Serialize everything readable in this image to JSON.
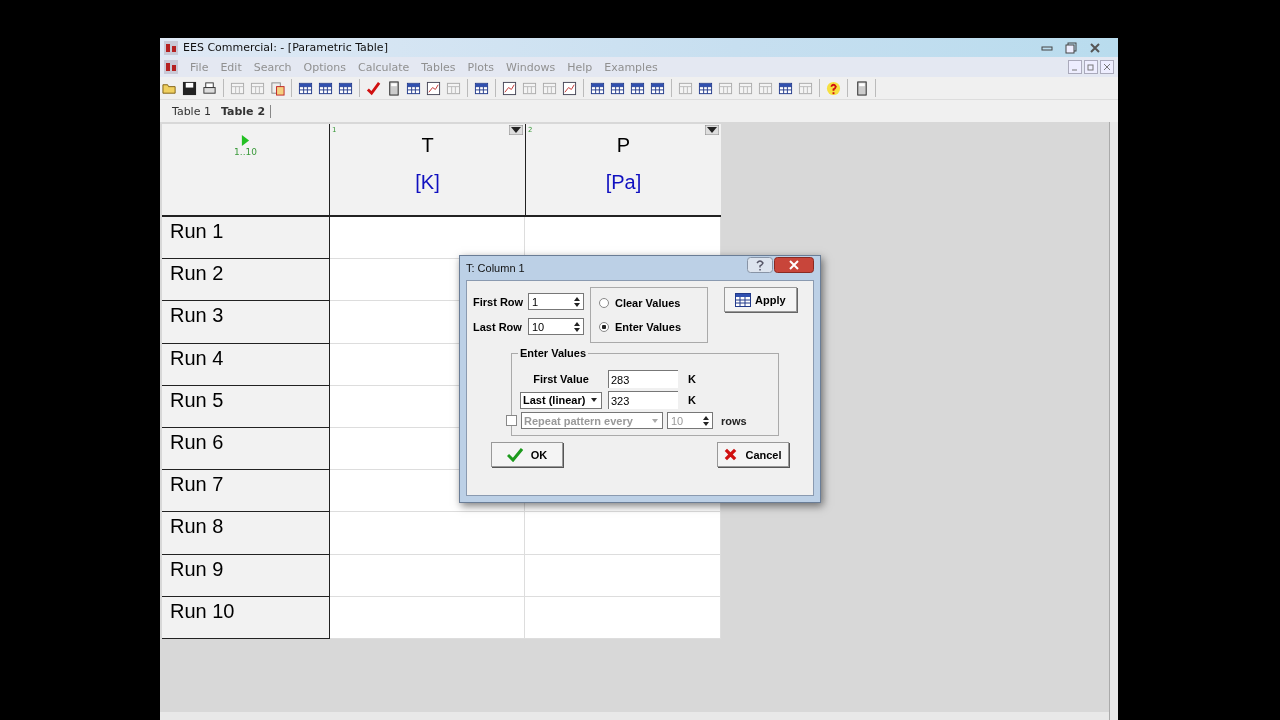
{
  "window": {
    "title": "EES Commercial:   - [Parametric Table]"
  },
  "menu": [
    "File",
    "Edit",
    "Search",
    "Options",
    "Calculate",
    "Tables",
    "Plots",
    "Windows",
    "Help",
    "Examples"
  ],
  "tabs": [
    {
      "label": "Table 1",
      "selected": false
    },
    {
      "label": "Table 2",
      "selected": true
    }
  ],
  "table": {
    "row_range": "1..10",
    "columns": [
      {
        "index": "1",
        "name": "T",
        "unit": "[K]"
      },
      {
        "index": "2",
        "name": "P",
        "unit": "[Pa]"
      }
    ],
    "rows": [
      "Run 1",
      "Run 2",
      "Run 3",
      "Run 4",
      "Run 5",
      "Run 6",
      "Run 7",
      "Run 8",
      "Run 9",
      "Run 10"
    ]
  },
  "dialog": {
    "title": "T:  Column 1",
    "first_row_label": "First Row",
    "first_row": "1",
    "last_row_label": "Last Row",
    "last_row": "10",
    "modes": [
      {
        "label": "Clear Values",
        "selected": false
      },
      {
        "label": "Enter Values",
        "selected": true
      }
    ],
    "apply": "Apply",
    "group_title": "Enter Values",
    "first_value_label": "First Value",
    "first_value": "283",
    "first_value_unit": "K",
    "last_mode": "Last (linear)",
    "last_value": "323",
    "last_value_unit": "K",
    "repeat": {
      "checked": false,
      "disabled": true,
      "label": "Repeat pattern every",
      "count": "10",
      "unit": "rows"
    },
    "ok": "OK",
    "cancel": "Cancel"
  }
}
